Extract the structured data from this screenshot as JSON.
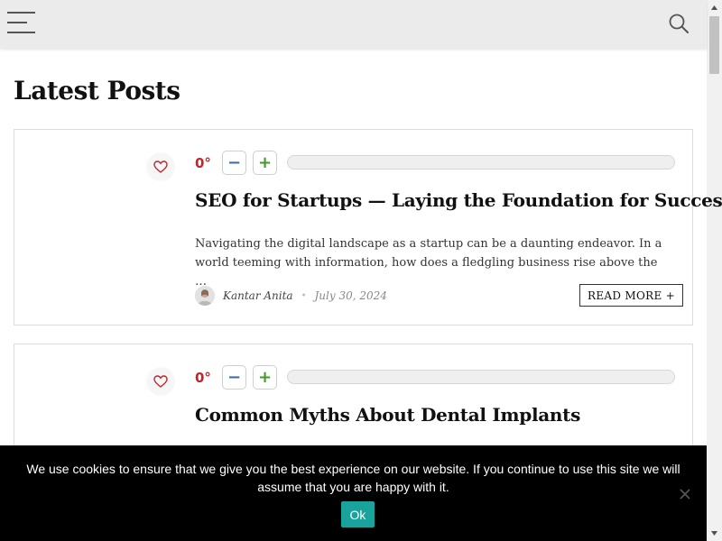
{
  "header": {
    "menu_icon": "hamburger-icon",
    "search_icon": "search-icon"
  },
  "page": {
    "title": "Latest Posts"
  },
  "posts": [
    {
      "score": "0°",
      "minus_label": "−",
      "plus_label": "+",
      "title": "SEO for Startups — Laying the Foundation for Success",
      "excerpt": "Navigating the digital landscape as a startup can be a daunting endeavor. In a world teeming with information, how does a fledgling business rise above the …",
      "author": "Kantar Anita",
      "separator": "•",
      "date": "July 30, 2024",
      "read_more": "READ MORE +"
    },
    {
      "score": "0°",
      "minus_label": "−",
      "plus_label": "+",
      "title": "Common Myths About Dental Implants"
    }
  ],
  "cookie_notice": {
    "text": "We use cookies to ensure that we give you the best experience on our website. If you continue to use this site we will assume that you are happy with it.",
    "ok_label": "Ok",
    "close_icon": "close-icon"
  },
  "colors": {
    "score": "#c0272d",
    "minus": "#3a6ea5",
    "plus": "#3f9a2a",
    "ok_button": "#1aa39d",
    "header_bg": "#ebebeb",
    "cookie_bg": "#000000"
  }
}
